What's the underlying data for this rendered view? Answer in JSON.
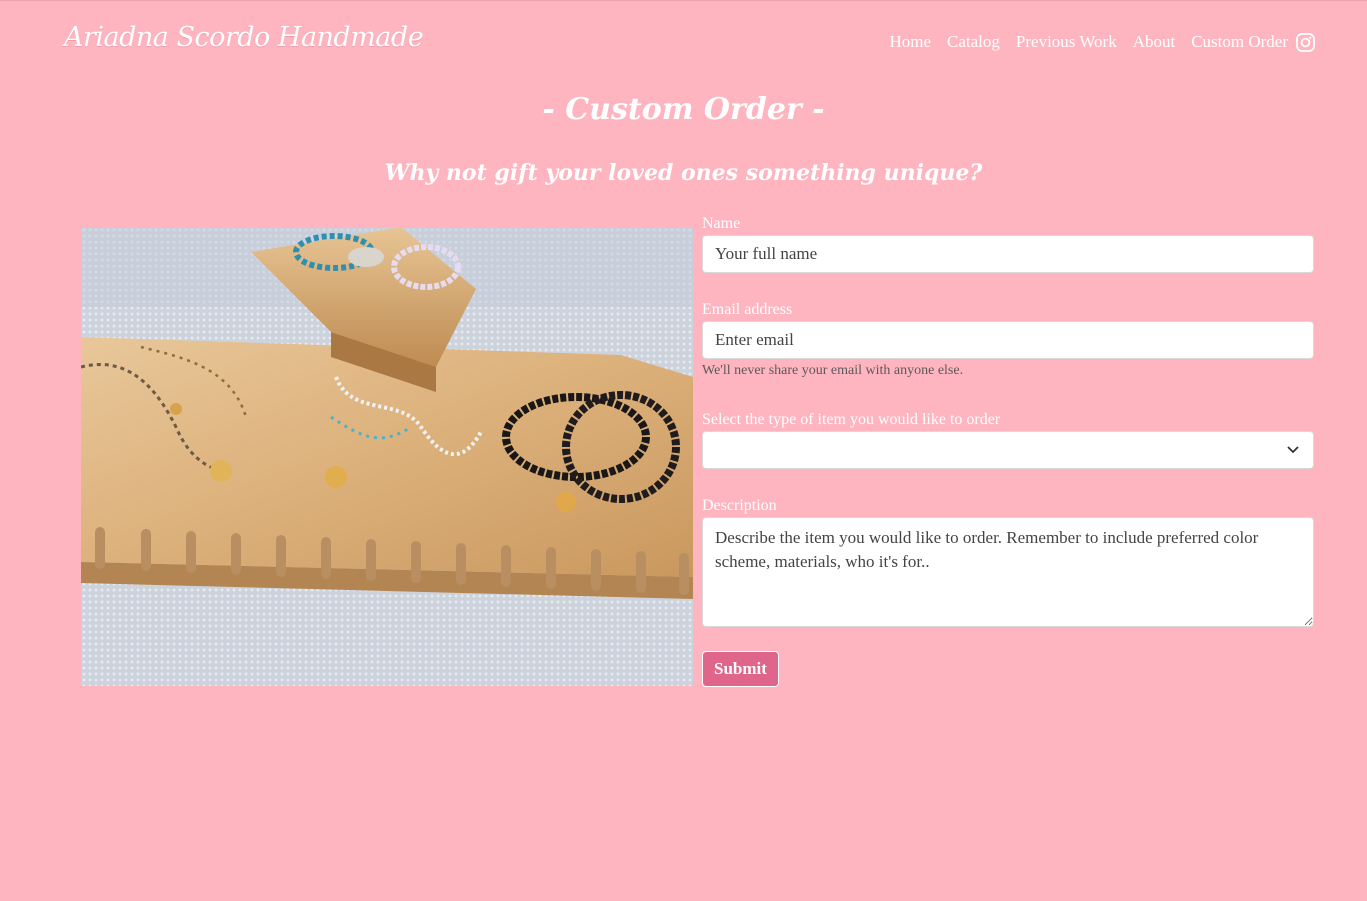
{
  "site": {
    "brand": "Ariadna Scordo Handmade",
    "nav": [
      "Home",
      "Catalog",
      "Previous Work",
      "About",
      "Custom Order"
    ],
    "instagram_icon": "instagram-icon"
  },
  "page": {
    "title": "- Custom Order -",
    "subtitle": "Why not gift your loved ones something unique?"
  },
  "form": {
    "name_label": "Name",
    "name_placeholder": "Your full name",
    "email_label": "Email address",
    "email_placeholder": "Enter email",
    "email_help": "We'll never share your email with anyone else.",
    "type_label": "Select the type of item you would like to order",
    "type_value": "",
    "description_label": "Description",
    "description_placeholder": "Describe the item you would like to order. Remember to include preferred color scheme, materials, who it's for..",
    "submit_label": "Submit"
  },
  "colors": {
    "background": "#ffb5c0",
    "button": "#e0658b"
  }
}
